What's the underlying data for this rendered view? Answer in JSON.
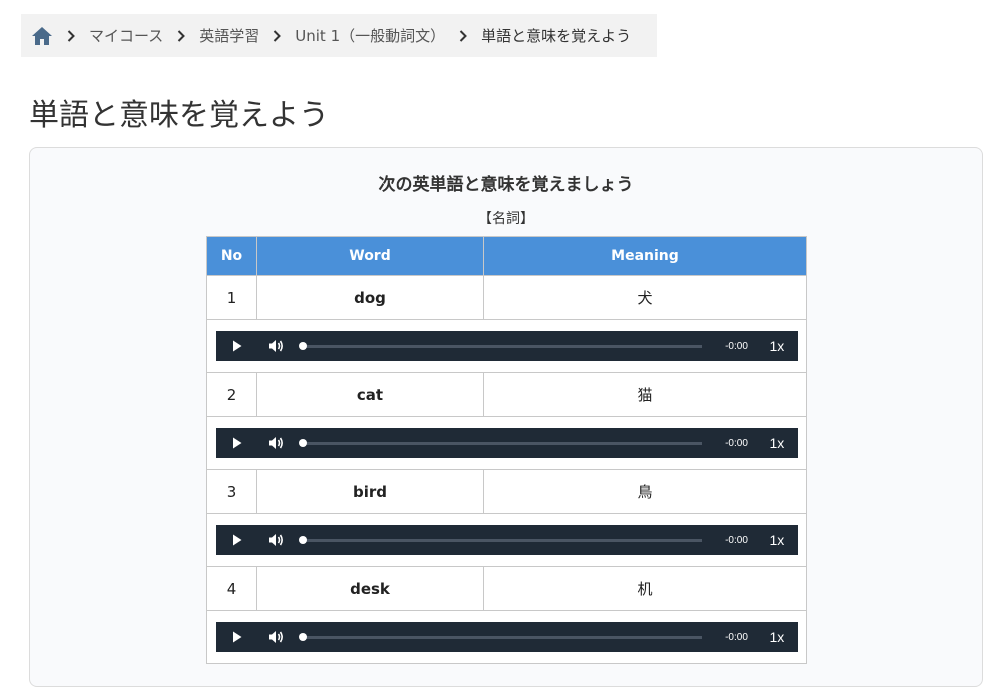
{
  "breadcrumb": {
    "items": [
      "マイコース",
      "英語学習",
      "Unit 1（一般動詞文）"
    ],
    "current": "単語と意味を覚えよう"
  },
  "page": {
    "title": "単語と意味を覚えよう"
  },
  "card": {
    "heading": "次の英単語と意味を覚えましょう",
    "part_of_speech": "【名詞】"
  },
  "table": {
    "headers": {
      "no": "No",
      "word": "Word",
      "meaning": "Meaning"
    },
    "rows": [
      {
        "no": "1",
        "word": "dog",
        "meaning": "犬"
      },
      {
        "no": "2",
        "word": "cat",
        "meaning": "猫"
      },
      {
        "no": "3",
        "word": "bird",
        "meaning": "鳥"
      },
      {
        "no": "4",
        "word": "desk",
        "meaning": "机"
      }
    ]
  },
  "player": {
    "time": "-0:00",
    "rate": "1x",
    "progress": 0
  },
  "colors": {
    "header_bg": "#4a90d9",
    "player_bg": "#1f2a36",
    "home_icon": "#4a6a8a"
  }
}
